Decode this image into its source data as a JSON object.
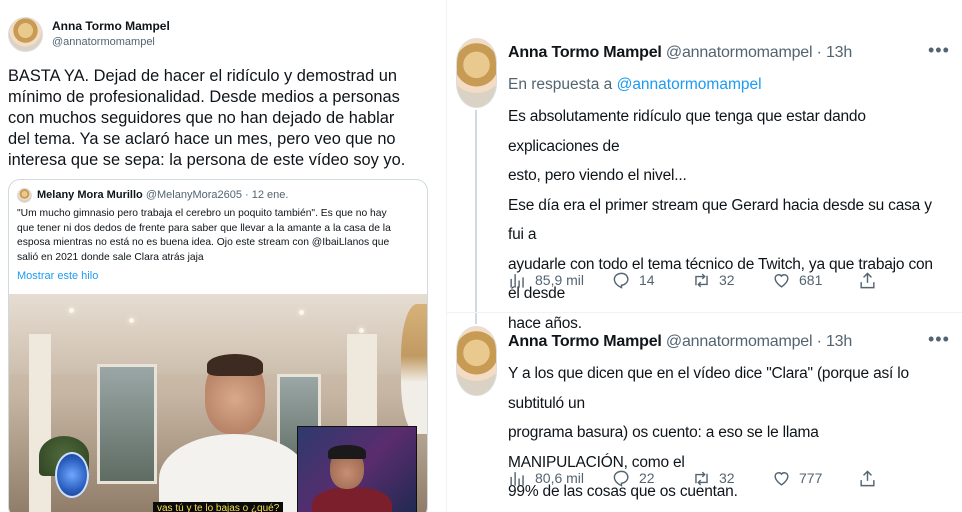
{
  "left_tweet": {
    "author_name": "Anna Tormo Mampel",
    "author_handle": "@annatormomampel",
    "lines": [
      "BASTA YA. Dejad de hacer el ridículo y demostrad un",
      "mínimo de profesionalidad. Desde medios a personas",
      "con muchos seguidores que no han dejado de hablar",
      "del tema. Ya se aclaró hace un mes, pero veo que no",
      "interesa que se sepa: la persona de este vídeo soy yo."
    ],
    "quote": {
      "author_name": "Melany Mora Murillo",
      "author_handle": "@MelanyMora2605",
      "date": "· 12 ene.",
      "lines": [
        "\"Um mucho gimnasio pero trabaja el cerebro un poquito también\". Es que no hay",
        "que tener ni dos dedos de frente para saber que llevar a la amante a la casa de la",
        "esposa mientras no está no es buena idea. Ojo este stream con @IbaiLlanos que",
        "salió en 2021 donde sale Clara atrás jaja"
      ],
      "show_thread": "Mostrar este hilo",
      "video_caption": "vas tú y te lo bajas o ¿qué?"
    }
  },
  "right_thread": {
    "tweets": [
      {
        "author_name": "Anna Tormo Mampel",
        "author_handle": "@annatormomampel",
        "time": "· 13h",
        "reply_prefix": "En respuesta a",
        "reply_to": "@annatormomampel",
        "lines": [
          "Es absolutamente ridículo que tenga que estar dando explicaciones de",
          "esto, pero viendo el nivel...",
          "Ese día era el primer stream que Gerard hacia desde su casa y fui a",
          "ayudarle con todo el tema técnico de Twitch, ya que trabajo con él desde",
          "hace años."
        ],
        "stats": {
          "views": "85,9 mil",
          "replies": "14",
          "retweets": "32",
          "likes": "681"
        }
      },
      {
        "author_name": "Anna Tormo Mampel",
        "author_handle": "@annatormomampel",
        "time": "· 13h",
        "lines": [
          "Y a los que dicen que en el vídeo dice \"Clara\" (porque así lo subtituló un",
          "programa basura) os cuento: a eso se le llama MANIPULACIÓN, como el",
          "99% de las cosas que os cuentan."
        ],
        "stats": {
          "views": "80,6 mil",
          "replies": "22",
          "retweets": "32",
          "likes": "777"
        }
      }
    ],
    "more_icon": "more-horizontal-icon"
  },
  "colors": {
    "link": "#1d9bf0",
    "muted": "#536471",
    "text": "#0f1419",
    "border": "#cfd9de"
  }
}
